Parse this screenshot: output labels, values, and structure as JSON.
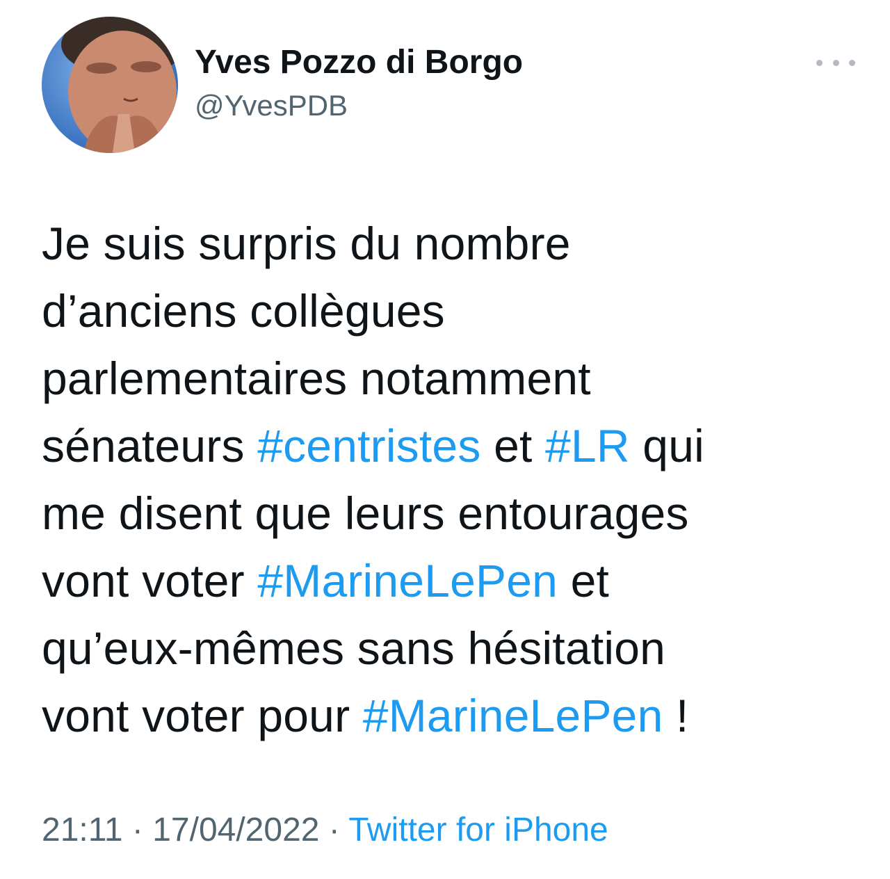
{
  "author": {
    "display_name": "Yves Pozzo di Borgo",
    "handle": "@YvesPDB"
  },
  "menu": {
    "icon": "more-horizontal-icon"
  },
  "tweet": {
    "lines": [
      [
        {
          "text": "Je suis surpris du nombre"
        }
      ],
      [
        {
          "text": "d’anciens collègues"
        }
      ],
      [
        {
          "text": "parlementaires notamment"
        }
      ],
      [
        {
          "text": "sénateurs "
        },
        {
          "text": "#centristes",
          "hashtag": true
        },
        {
          "text": " et "
        },
        {
          "text": "#LR",
          "hashtag": true
        },
        {
          "text": " qui"
        }
      ],
      [
        {
          "text": "me disent que leurs entourages"
        }
      ],
      [
        {
          "text": "vont voter "
        },
        {
          "text": "#MarineLePen",
          "hashtag": true
        },
        {
          "text": " et"
        }
      ],
      [
        {
          "text": "qu’eux-mêmes sans hésitation"
        }
      ],
      [
        {
          "text": "vont voter pour "
        },
        {
          "text": "#MarineLePen",
          "hashtag": true
        },
        {
          "text": " !"
        }
      ]
    ]
  },
  "meta": {
    "time": "21:11",
    "separator": " · ",
    "date": "17/04/2022",
    "source": "Twitter for iPhone"
  },
  "colors": {
    "text": "#0f1419",
    "secondary": "#536471",
    "link": "#1d9bf0"
  }
}
